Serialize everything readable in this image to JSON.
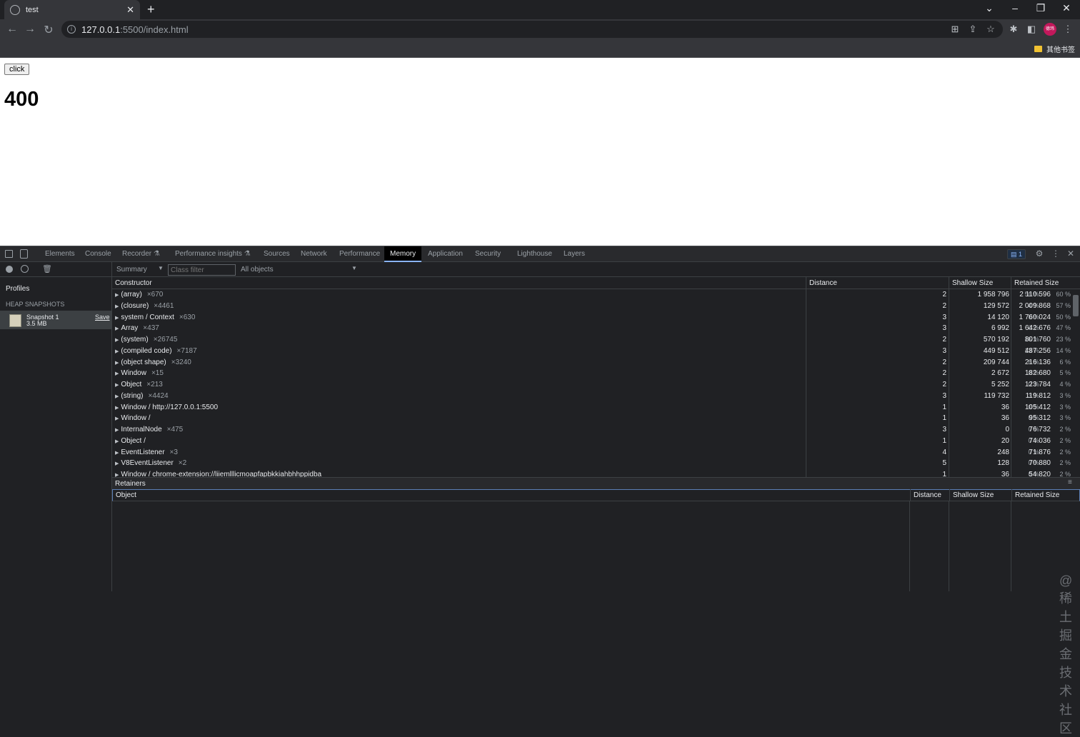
{
  "browser": {
    "tab_title": "test",
    "url_host": "127.0.0.1",
    "url_path": ":5500/index.html",
    "avatar_label": "德玮",
    "bookmark_other": "其他书签"
  },
  "page": {
    "button_label": "click",
    "count": "400"
  },
  "devtools": {
    "tabs": [
      "Elements",
      "Console",
      "Recorder ⚗",
      "Performance insights ⚗",
      "Sources",
      "Network",
      "Performance",
      "Memory",
      "Application",
      "Security",
      "Lighthouse",
      "Layers"
    ],
    "active_tab": "Memory",
    "issues_count": "1",
    "sidebar": {
      "profiles": "Profiles",
      "heap_header": "HEAP SNAPSHOTS",
      "snapshot_name": "Snapshot 1",
      "snapshot_size": "3.5 MB",
      "save_label": "Save"
    },
    "toolbar": {
      "view": "Summary",
      "class_filter_placeholder": "Class filter",
      "filter": "All objects"
    },
    "columns": {
      "constructor": "Constructor",
      "distance": "Distance",
      "shallow": "Shallow Size",
      "retained": "Retained Size"
    },
    "rows": [
      {
        "name": "(array)",
        "count": "×670",
        "distance": "2",
        "shallow": "1 958 796",
        "shallow_pct": "56 %",
        "retained": "2 110 596",
        "retained_pct": "60 %"
      },
      {
        "name": "(closure)",
        "count": "×4461",
        "distance": "2",
        "shallow": "129 572",
        "shallow_pct": "4 %",
        "retained": "2 009 868",
        "retained_pct": "57 %"
      },
      {
        "name": "system / Context",
        "count": "×630",
        "distance": "3",
        "shallow": "14 120",
        "shallow_pct": "0 %",
        "retained": "1 760 024",
        "retained_pct": "50 %"
      },
      {
        "name": "Array",
        "count": "×437",
        "distance": "3",
        "shallow": "6 992",
        "shallow_pct": "0 %",
        "retained": "1 642 676",
        "retained_pct": "47 %"
      },
      {
        "name": "(system)",
        "count": "×26745",
        "distance": "2",
        "shallow": "570 192",
        "shallow_pct": "16 %",
        "retained": "801 760",
        "retained_pct": "23 %"
      },
      {
        "name": "(compiled code)",
        "count": "×7187",
        "distance": "3",
        "shallow": "449 512",
        "shallow_pct": "13 %",
        "retained": "487 256",
        "retained_pct": "14 %"
      },
      {
        "name": "(object shape)",
        "count": "×3240",
        "distance": "2",
        "shallow": "209 744",
        "shallow_pct": "6 %",
        "retained": "216 136",
        "retained_pct": "6 %"
      },
      {
        "name": "Window",
        "count": "×15",
        "distance": "2",
        "shallow": "2 672",
        "shallow_pct": "0 %",
        "retained": "182 680",
        "retained_pct": "5 %"
      },
      {
        "name": "Object",
        "count": "×213",
        "distance": "2",
        "shallow": "5 252",
        "shallow_pct": "0 %",
        "retained": "123 784",
        "retained_pct": "4 %"
      },
      {
        "name": "(string)",
        "count": "×4424",
        "distance": "3",
        "shallow": "119 732",
        "shallow_pct": "3 %",
        "retained": "119 812",
        "retained_pct": "3 %"
      },
      {
        "name": "Window / http://127.0.0.1:5500",
        "count": "",
        "distance": "1",
        "shallow": "36",
        "shallow_pct": "0 %",
        "retained": "105 412",
        "retained_pct": "3 %"
      },
      {
        "name": "Window /",
        "count": "",
        "distance": "1",
        "shallow": "36",
        "shallow_pct": "0 %",
        "retained": "95 312",
        "retained_pct": "3 %"
      },
      {
        "name": "InternalNode",
        "count": "×475",
        "distance": "3",
        "shallow": "0",
        "shallow_pct": "0 %",
        "retained": "76 732",
        "retained_pct": "2 %"
      },
      {
        "name": "Object /",
        "count": "",
        "distance": "1",
        "shallow": "20",
        "shallow_pct": "0 %",
        "retained": "74 036",
        "retained_pct": "2 %"
      },
      {
        "name": "EventListener",
        "count": "×3",
        "distance": "4",
        "shallow": "248",
        "shallow_pct": "0 %",
        "retained": "71 876",
        "retained_pct": "2 %"
      },
      {
        "name": "V8EventListener",
        "count": "×2",
        "distance": "5",
        "shallow": "128",
        "shallow_pct": "0 %",
        "retained": "70 880",
        "retained_pct": "2 %"
      },
      {
        "name": "Window / chrome-extension://liiemlllicmoapfapbkkiahbhhppidba",
        "count": "",
        "distance": "1",
        "shallow": "36",
        "shallow_pct": "0 %",
        "retained": "54 820",
        "retained_pct": "2 %"
      }
    ],
    "retainers": {
      "title": "Retainers",
      "object": "Object",
      "distance": "Distance",
      "shallow": "Shallow Size",
      "retained": "Retained Size"
    },
    "watermark": "@稀土掘金技术社区"
  }
}
